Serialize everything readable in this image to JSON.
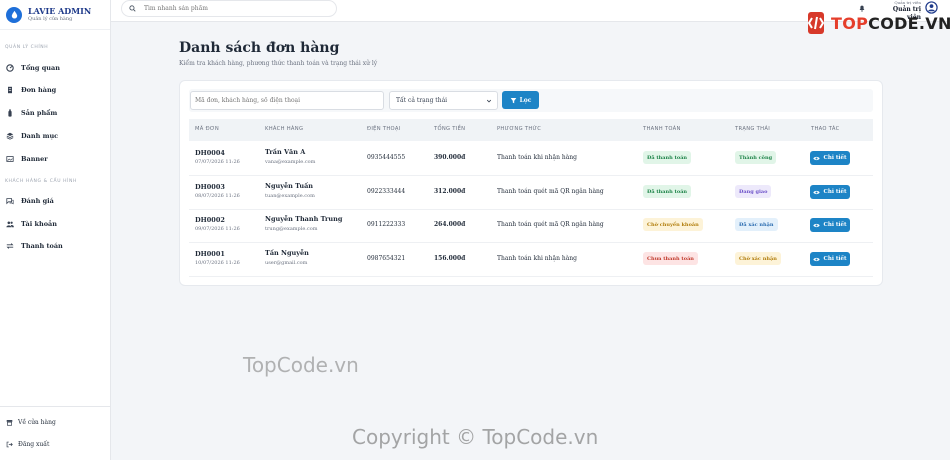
{
  "brand": {
    "title": "LAVIE ADMIN",
    "subtitle": "Quản lý cửa hàng"
  },
  "sidebar": {
    "section1": "QUẢN LÝ CHÍNH",
    "main_items": [
      {
        "label": "Tổng quan",
        "icon": "dashboard-icon"
      },
      {
        "label": "Đơn hàng",
        "icon": "receipt-icon"
      },
      {
        "label": "Sản phẩm",
        "icon": "bottle-icon"
      },
      {
        "label": "Danh mục",
        "icon": "layers-icon"
      },
      {
        "label": "Banner",
        "icon": "image-icon"
      }
    ],
    "section2": "KHÁCH HÀNG & CẤU HÌNH",
    "customer_items": [
      {
        "label": "Đánh giá",
        "icon": "comments-icon"
      },
      {
        "label": "Tài khoản",
        "icon": "users-icon"
      },
      {
        "label": "Thanh toán",
        "icon": "transfer-icon"
      }
    ],
    "bottom_items": [
      {
        "label": "Về cửa hàng",
        "icon": "store-icon"
      },
      {
        "label": "Đăng xuất",
        "icon": "logout-icon"
      }
    ]
  },
  "topbar": {
    "search_placeholder": "Tìm nhanh sản phẩm",
    "admin_sub": "Quản trị viên",
    "admin_name": "Quản trị viên"
  },
  "page": {
    "title": "Danh sách đơn hàng",
    "subtitle": "Kiểm tra khách hàng, phương thức thanh toán và trạng thái xử lý"
  },
  "filter": {
    "search_placeholder": "Mã đơn, khách hàng, số điện thoại",
    "status_selected": "Tất cả trạng thái",
    "button_label": "Lọc"
  },
  "table": {
    "headers": [
      "MÃ ĐƠN",
      "KHÁCH HÀNG",
      "ĐIỆN THOẠI",
      "TỔNG TIỀN",
      "PHƯƠNG THỨC",
      "THANH TOÁN",
      "TRẠNG THÁI",
      "THAO TÁC"
    ],
    "detail_label": "Chi tiết",
    "rows": [
      {
        "code": "DH0004",
        "date": "07/07/2026 11:26",
        "name": "Trần Văn A",
        "email": "vana@example.com",
        "phone": "0935444555",
        "total": "390.000đ",
        "method": "Thanh toán khi nhận hàng",
        "payment": "Đã thanh toán",
        "payment_color": "green",
        "status": "Thành công",
        "status_color": "green"
      },
      {
        "code": "DH0003",
        "date": "08/07/2026 11:26",
        "name": "Nguyễn Tuấn",
        "email": "tuan@example.com",
        "phone": "0922333444",
        "total": "312.000đ",
        "method": "Thanh toán quét mã QR ngân hàng",
        "payment": "Đã thanh toán",
        "payment_color": "green",
        "status": "Đang giao",
        "status_color": "purple"
      },
      {
        "code": "DH0002",
        "date": "09/07/2026 11:26",
        "name": "Nguyễn Thanh Trung",
        "email": "trung@example.com",
        "phone": "0911222333",
        "total": "264.000đ",
        "method": "Thanh toán quét mã QR ngân hàng",
        "payment": "Chờ chuyển khoản",
        "payment_color": "yellow",
        "status": "Đã xác nhận",
        "status_color": "blue"
      },
      {
        "code": "DH0001",
        "date": "10/07/2026 11:26",
        "name": "Tấn Nguyễn",
        "email": "user@gmail.com",
        "phone": "0987654321",
        "total": "156.000đ",
        "method": "Thanh toán khi nhận hàng",
        "payment": "Chưa thanh toán",
        "payment_color": "red",
        "status": "Chờ xác nhận",
        "status_color": "yellow"
      }
    ]
  },
  "watermark": {
    "logo_prefix": "TOP",
    "logo_suffix": "CODE.VN",
    "middle": "TopCode.vn",
    "bottom": "Copyright © TopCode.vn"
  }
}
